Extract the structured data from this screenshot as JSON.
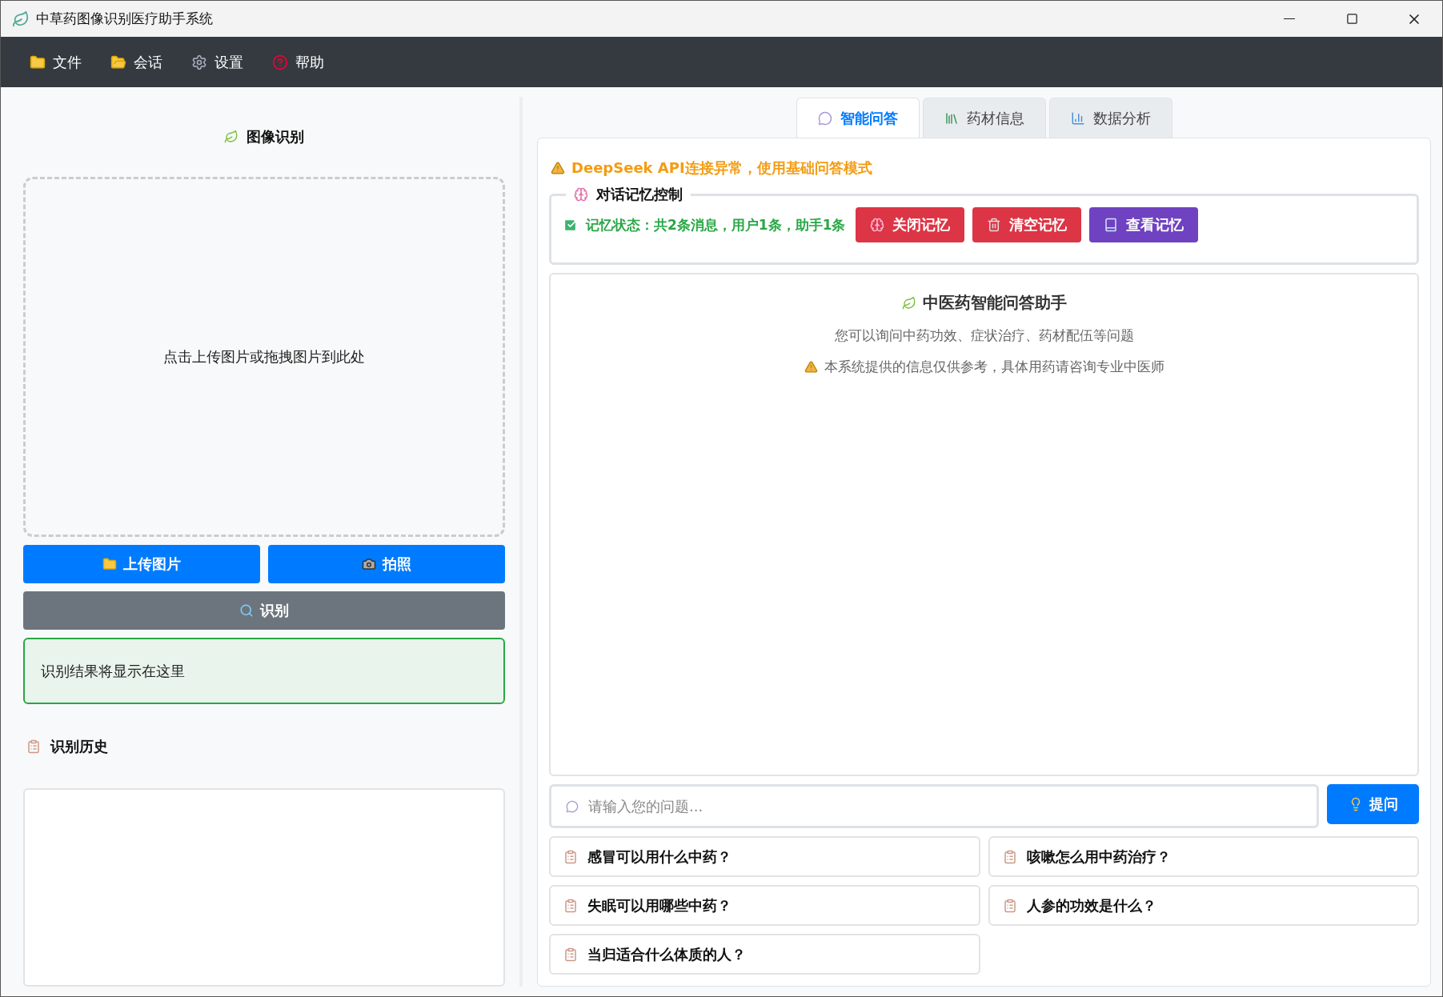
{
  "window": {
    "title": "中草药图像识别医疗助手系统"
  },
  "menu": [
    {
      "label": "文件",
      "kind": "folder"
    },
    {
      "label": "会话",
      "kind": "session"
    },
    {
      "label": "设置",
      "kind": "settings"
    },
    {
      "label": "帮助",
      "kind": "help"
    }
  ],
  "left": {
    "title": "图像识别",
    "dropzone": "点击上传图片或拖拽图片到此处",
    "upload_button": "上传图片",
    "camera_button": "拍照",
    "recognize_button": "识别",
    "result": "识别结果将显示在这里",
    "history_title": "识别历史"
  },
  "tabs": [
    {
      "label": "智能问答",
      "kind": "chat",
      "selected": true
    },
    {
      "label": "药材信息",
      "kind": "books",
      "selected": false
    },
    {
      "label": "数据分析",
      "kind": "chart",
      "selected": false
    }
  ],
  "warning": "DeepSeek API连接异常，使用基础问答模式",
  "memory": {
    "title": "对话记忆控制",
    "status": "记忆状态：共2条消息，用户1条，助手1条",
    "buttons": [
      {
        "label": "关闭记忆",
        "kind": "brain"
      },
      {
        "label": "清空记忆",
        "kind": "trash"
      },
      {
        "label": "查看记忆",
        "kind": "book"
      }
    ]
  },
  "chat": {
    "title": "中医药智能问答助手",
    "subtitle": "您可以询问中药功效、症状治疗、药材配伍等问题",
    "notice": "本系统提供的信息仅供参考，具体用药请咨询专业中医师"
  },
  "input": {
    "placeholder": "请输入您的问题...",
    "button": "提问"
  },
  "quick_questions": [
    "感冒可以用什么中药？",
    "咳嗽怎么用中药治疗？",
    "失眠可以用哪些中药？",
    "人参的功效是什么？",
    "当归适合什么体质的人？"
  ]
}
